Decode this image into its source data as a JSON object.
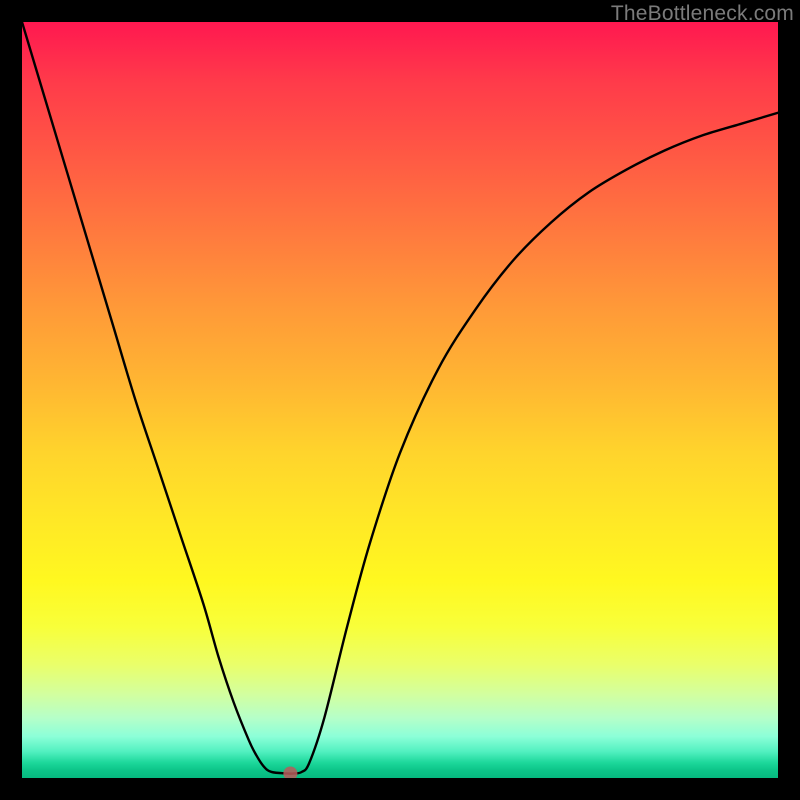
{
  "watermark": "TheBottleneck.com",
  "chart_data": {
    "type": "line",
    "title": "",
    "xlabel": "",
    "ylabel": "",
    "xlim": [
      0,
      100
    ],
    "ylim": [
      0,
      100
    ],
    "grid": false,
    "legend": false,
    "series": [
      {
        "name": "bottleneck-curve",
        "x": [
          0,
          3,
          6,
          9,
          12,
          15,
          18,
          21,
          24,
          26,
          28,
          30,
          31,
          32,
          33,
          35,
          36,
          37,
          38,
          40,
          43,
          46,
          50,
          55,
          60,
          65,
          70,
          75,
          80,
          85,
          90,
          95,
          100
        ],
        "y": [
          100,
          90,
          80,
          70,
          60,
          50,
          41,
          32,
          23,
          16,
          10,
          5,
          3,
          1.5,
          0.8,
          0.6,
          0.6,
          0.8,
          2,
          8,
          20,
          31,
          43,
          54,
          62,
          68.5,
          73.5,
          77.5,
          80.5,
          83,
          85,
          86.5,
          88
        ]
      }
    ],
    "marker": {
      "x": 35.5,
      "y": 0.6,
      "color": "#b85a5a",
      "radius": 7
    },
    "background_gradient": {
      "direction": "vertical",
      "stops": [
        {
          "pos": 0.0,
          "color": "#ff1850"
        },
        {
          "pos": 0.18,
          "color": "#ff5a44"
        },
        {
          "pos": 0.38,
          "color": "#ff9a38"
        },
        {
          "pos": 0.57,
          "color": "#ffd42c"
        },
        {
          "pos": 0.74,
          "color": "#fff820"
        },
        {
          "pos": 0.89,
          "color": "#d2ffa0"
        },
        {
          "pos": 0.98,
          "color": "#1cd79a"
        },
        {
          "pos": 1.0,
          "color": "#06b97f"
        }
      ]
    }
  }
}
